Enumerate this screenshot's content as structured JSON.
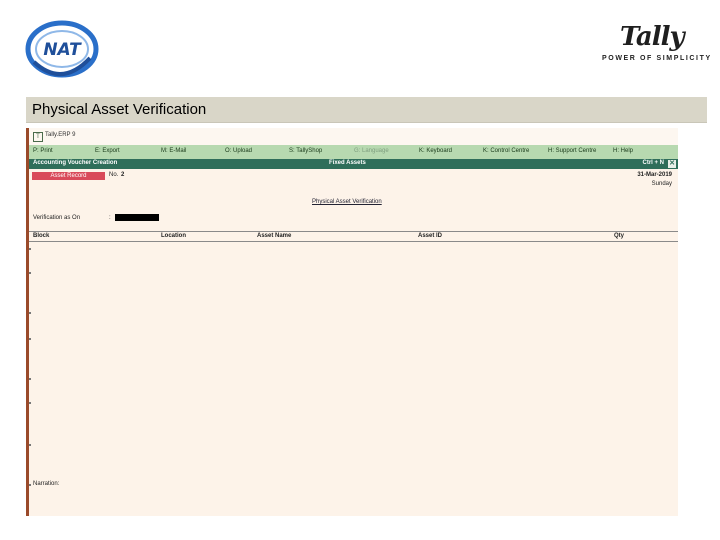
{
  "slide": {
    "title": "Physical Asset Verification",
    "nat_logo_text": "NAT",
    "tally_logo_text": "Tally",
    "tally_tagline": "POWER OF SIMPLICITY"
  },
  "window": {
    "title": "Tally.ERP 9"
  },
  "menu": [
    {
      "label": "P: Print",
      "enabled": true
    },
    {
      "label": "E: Export",
      "enabled": true
    },
    {
      "label": "M: E-Mail",
      "enabled": true
    },
    {
      "label": "O: Upload",
      "enabled": true
    },
    {
      "label": "S: TallyShop",
      "enabled": true
    },
    {
      "label": "G: Language",
      "enabled": false
    },
    {
      "label": "K: Keyboard",
      "enabled": true
    },
    {
      "label": "K: Control Centre",
      "enabled": true
    },
    {
      "label": "H: Support Centre",
      "enabled": true
    },
    {
      "label": "H: Help",
      "enabled": true
    }
  ],
  "header": {
    "left": "Accounting Voucher  Creation",
    "center": "Fixed Assets",
    "right": "Ctrl + N",
    "close": "✕"
  },
  "voucher": {
    "type": "Asset Record",
    "no_label": "No.",
    "no": "2",
    "date": "31-Mar-2019",
    "day": "Sunday"
  },
  "report": {
    "title": "Physical Asset Verification",
    "verification_label": "Verification as On",
    "verification_colon": ":",
    "verification_value": ""
  },
  "table": {
    "columns": [
      "Block",
      "Location",
      "Asset Name",
      "Asset ID",
      "Qty"
    ]
  },
  "narration_label": "Narration:"
}
